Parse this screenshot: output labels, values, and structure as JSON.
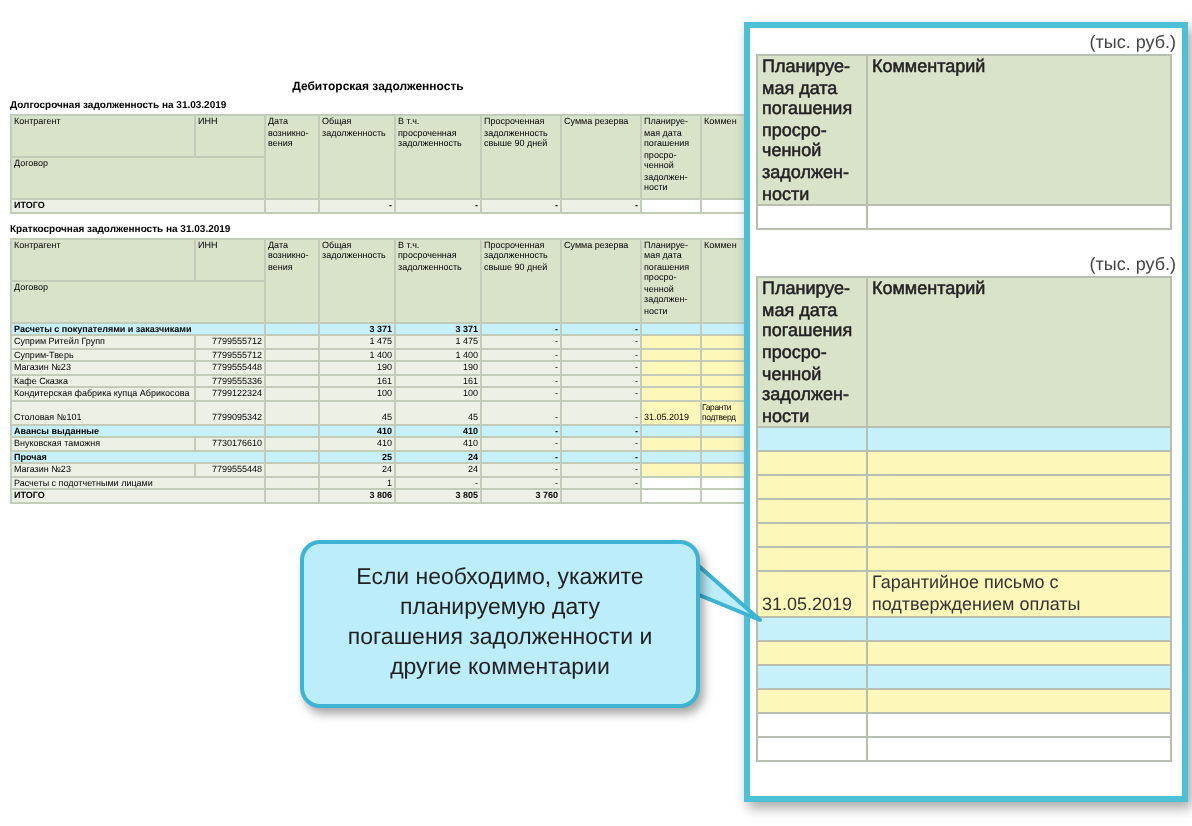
{
  "sheet": {
    "title": "Дебиторская задолженность",
    "sections": [
      {
        "heading": "Долгосрочная задолженность на 31.03.2019",
        "columns": [
          "Контрагент",
          "ИНН",
          "Дата возникно-вения",
          "Общая задолженность",
          "В т.ч. просроченная задолженность",
          "Просроченная задолженность свыше 90 дней",
          "Сумма резерва",
          "Планируе-мая дата погашения просро-ченной задолжен-ности",
          "Коммен"
        ],
        "subheader": "Договор",
        "rows": [
          {
            "kind": "total",
            "name": "ИТОГО",
            "values": [
              "-",
              "-",
              "-",
              "-"
            ],
            "input": false
          }
        ]
      },
      {
        "heading": "Краткосрочная задолженность на 31.03.2019",
        "columns": [
          "Контрагент",
          "ИНН",
          "Дата возникно-вения",
          "Общая задолженность",
          "В т.ч. просроченная задолженность",
          "Просроченная задолженность свыше 90 дней",
          "Сумма резерва",
          "Планируе-мая дата погашения просро-ченной задолжен-ности",
          "Коммен"
        ],
        "subheader": "Договор",
        "rows": [
          {
            "kind": "group",
            "name": "Расчеты с покупателями и заказчиками",
            "values": [
              "3 371",
              "3 371",
              "-",
              "-"
            ]
          },
          {
            "kind": "item",
            "name": "Суприм Ритейл Групп",
            "inn": "7799555712",
            "values": [
              "1 475",
              "1 475",
              "-",
              "-"
            ],
            "input": true
          },
          {
            "kind": "item",
            "name": "Суприм-Тверь",
            "inn": "7799555712",
            "values": [
              "1 400",
              "1 400",
              "-",
              "-"
            ],
            "input": true
          },
          {
            "kind": "item",
            "name": "Магазин №23",
            "inn": "7799555448",
            "values": [
              "190",
              "190",
              "-",
              "-"
            ],
            "input": true
          },
          {
            "kind": "item",
            "name": "Кафе Сказка",
            "inn": "7799555336",
            "values": [
              "161",
              "161",
              "-",
              "-"
            ],
            "input": true
          },
          {
            "kind": "item",
            "name": "Кондитерская фабрика купца Абрикосова",
            "inn": "7799122324",
            "values": [
              "100",
              "100",
              "-",
              "-"
            ],
            "input": true
          },
          {
            "kind": "item",
            "name": "Столовая №101",
            "inn": "7799095342",
            "values": [
              "45",
              "45",
              "-",
              "-"
            ],
            "plan": "31.05.2019",
            "comment": "Гаранти подтверд",
            "input": true
          },
          {
            "kind": "group",
            "name": "Авансы выданные",
            "values": [
              "410",
              "410",
              "-",
              "-"
            ]
          },
          {
            "kind": "item",
            "name": "Внуковская таможня",
            "inn": "7730176610",
            "values": [
              "410",
              "410",
              "-",
              "-"
            ],
            "input": true
          },
          {
            "kind": "group",
            "name": "Прочая",
            "values": [
              "25",
              "24",
              "-",
              "-"
            ]
          },
          {
            "kind": "item",
            "name": "Магазин №23",
            "inn": "7799555448",
            "values": [
              "24",
              "24",
              "-",
              "-"
            ],
            "input": true
          },
          {
            "kind": "item",
            "name": "Расчеты с подотчетными лицами",
            "values": [
              "1",
              "-",
              "-",
              "-"
            ],
            "input": false
          },
          {
            "kind": "total",
            "name": "ИТОГО",
            "values": [
              "3 806",
              "3 805",
              "3 760"
            ],
            "input": false
          }
        ]
      }
    ]
  },
  "zoom_panel": {
    "sections": [
      {
        "unit": "(тыс. руб.)",
        "columns": [
          "Планируе-мая дата погашения просро-ченной задолжен-ности",
          "Комментарий"
        ],
        "rows": [
          {
            "kind": "blank"
          }
        ]
      },
      {
        "unit": "(тыс. руб.)",
        "columns": [
          "Планируе-мая дата погашения просро-ченной задолжен-ности",
          "Комментарий"
        ],
        "rows": [
          {
            "kind": "group"
          },
          {
            "kind": "input"
          },
          {
            "kind": "input"
          },
          {
            "kind": "input"
          },
          {
            "kind": "input"
          },
          {
            "kind": "input"
          },
          {
            "kind": "input",
            "plan": "31.05.2019",
            "comment": "Гарантийное письмо с подтверждением оплаты"
          },
          {
            "kind": "group"
          },
          {
            "kind": "input"
          },
          {
            "kind": "group"
          },
          {
            "kind": "input"
          },
          {
            "kind": "blank"
          },
          {
            "kind": "blank"
          }
        ]
      }
    ]
  },
  "callout": {
    "text": "Если необходимо, укажите планируемую дату погашения задолженности и другие комментарии"
  }
}
